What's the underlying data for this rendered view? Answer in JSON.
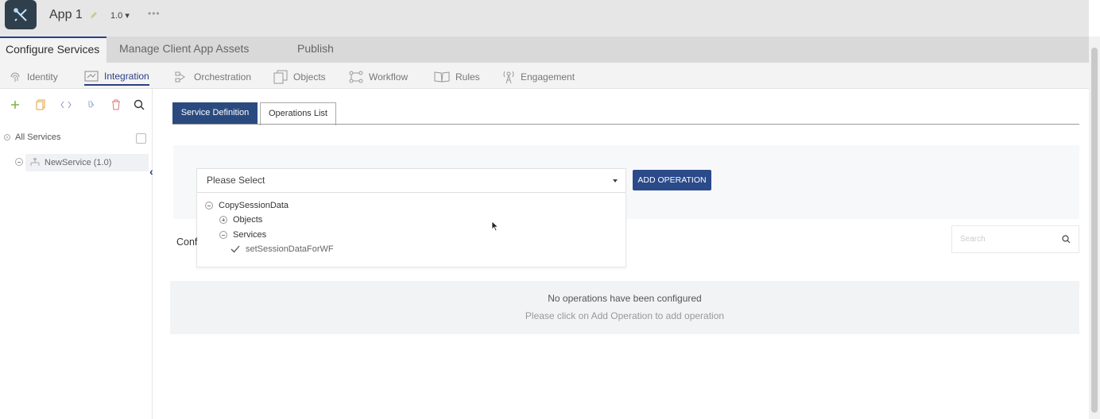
{
  "app": {
    "name": "App 1",
    "version": "1.0 ▾",
    "more": "•••"
  },
  "mainnav": {
    "tabs": [
      "Configure Services",
      "Manage Client App Assets",
      "Publish"
    ]
  },
  "subnav": {
    "items": [
      "Identity",
      "Integration",
      "Orchestration",
      "Objects",
      "Workflow",
      "Rules",
      "Engagement"
    ]
  },
  "sidebar": {
    "root_label": "All Services",
    "service_label": "NewService (1.0)"
  },
  "content": {
    "tabs": [
      "Service Definition",
      "Operations List"
    ],
    "dropdown_placeholder": "Please Select",
    "add_operation_label": "ADD OPERATION",
    "tree": {
      "root": "CopySessionData",
      "objects": "Objects",
      "services": "Services",
      "operation": "setSessionDataForWF"
    },
    "conf_label": "Conf",
    "search_placeholder": "Search",
    "empty_title": "No operations have been configured",
    "empty_subtitle": "Please click on Add Operation to add operation"
  },
  "colors": {
    "accent": "#2a4a8a",
    "add_icon": "#7cb342",
    "copy_icon": "#e6a23c",
    "delete_icon": "#e57373"
  }
}
